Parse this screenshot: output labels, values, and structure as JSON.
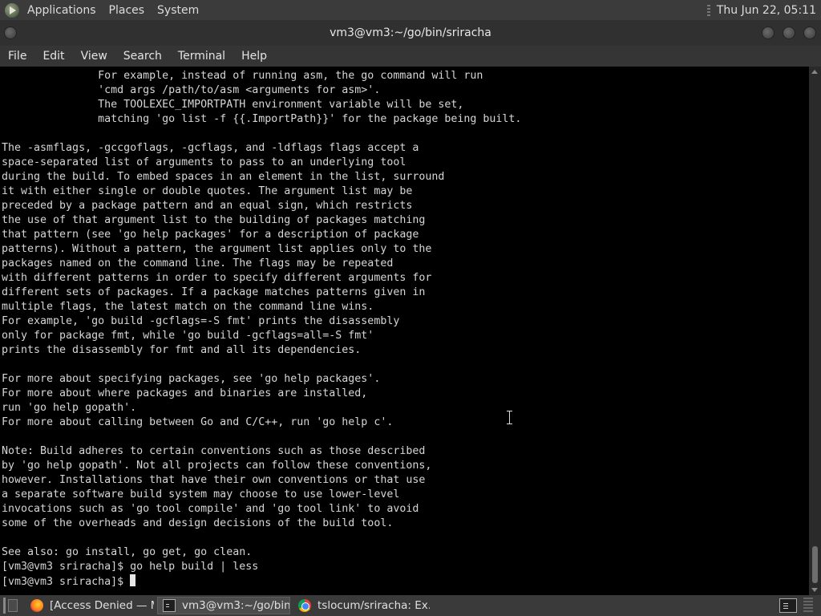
{
  "top_panel": {
    "menus": [
      "Applications",
      "Places",
      "System"
    ],
    "clock": "Thu Jun 22, 05:11"
  },
  "window": {
    "title": "vm3@vm3:~/go/bin/sriracha",
    "menus": [
      "File",
      "Edit",
      "View",
      "Search",
      "Terminal",
      "Help"
    ]
  },
  "terminal": {
    "lines": [
      "               For example, instead of running asm, the go command will run",
      "               'cmd args /path/to/asm <arguments for asm>'.",
      "               The TOOLEXEC_IMPORTPATH environment variable will be set,",
      "               matching 'go list -f {{.ImportPath}}' for the package being built.",
      "",
      "The -asmflags, -gccgoflags, -gcflags, and -ldflags flags accept a",
      "space-separated list of arguments to pass to an underlying tool",
      "during the build. To embed spaces in an element in the list, surround",
      "it with either single or double quotes. The argument list may be",
      "preceded by a package pattern and an equal sign, which restricts",
      "the use of that argument list to the building of packages matching",
      "that pattern (see 'go help packages' for a description of package",
      "patterns). Without a pattern, the argument list applies only to the",
      "packages named on the command line. The flags may be repeated",
      "with different patterns in order to specify different arguments for",
      "different sets of packages. If a package matches patterns given in",
      "multiple flags, the latest match on the command line wins.",
      "For example, 'go build -gcflags=-S fmt' prints the disassembly",
      "only for package fmt, while 'go build -gcflags=all=-S fmt'",
      "prints the disassembly for fmt and all its dependencies.",
      "",
      "For more about specifying packages, see 'go help packages'.",
      "For more about where packages and binaries are installed,",
      "run 'go help gopath'.",
      "For more about calling between Go and C/C++, run 'go help c'.",
      "",
      "Note: Build adheres to certain conventions such as those described",
      "by 'go help gopath'. Not all projects can follow these conventions,",
      "however. Installations that have their own conventions or that use",
      "a separate software build system may choose to use lower-level",
      "invocations such as 'go tool compile' and 'go tool link' to avoid",
      "some of the overheads and design decisions of the build tool.",
      "",
      "See also: go install, go get, go clean.",
      "[vm3@vm3 sriracha]$ go help build | less"
    ],
    "prompt": "[vm3@vm3 sriracha]$ "
  },
  "taskbar": {
    "tasks": [
      {
        "label": "[Access Denied — M...",
        "icon": "firefox-icon",
        "active": false
      },
      {
        "label": "vm3@vm3:~/go/bin...",
        "icon": "terminal-icon",
        "active": true
      },
      {
        "label": "tslocum/sriracha: Ex...",
        "icon": "chrome-icon",
        "active": false
      }
    ]
  },
  "colors": {
    "terminal_bg": "#000000",
    "terminal_fg": "#d6d6d6",
    "panel_bg": "#3b3b3b"
  }
}
